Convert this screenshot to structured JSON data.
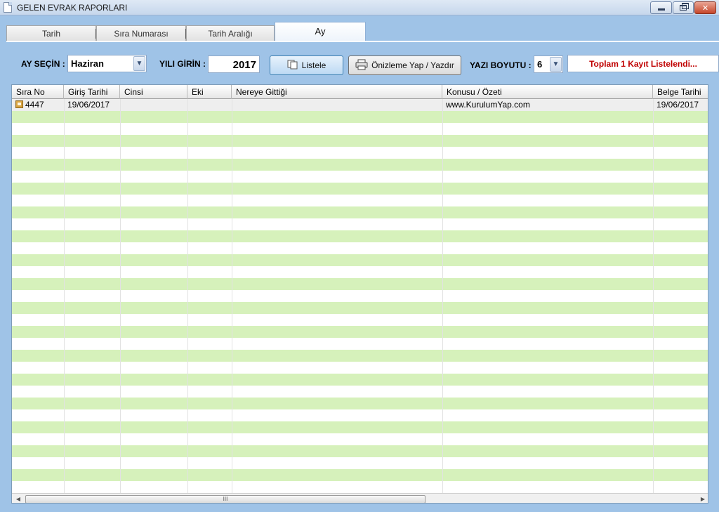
{
  "window": {
    "title": "GELEN EVRAK RAPORLARI",
    "controls": {
      "minimize": "minimize",
      "maximize": "restore",
      "close": "✕"
    }
  },
  "tabs": [
    {
      "label": "Tarih",
      "active": false
    },
    {
      "label": "Sıra Numarası",
      "active": false
    },
    {
      "label": "Tarih Aralığı",
      "active": false
    },
    {
      "label": "Ay",
      "active": true
    }
  ],
  "filters": {
    "month_label": "AY SEÇİN :",
    "month_value": "Haziran",
    "year_label": "YILI GİRİN :",
    "year_value": "2017",
    "list_button": "Listele",
    "print_button": "Önizleme Yap / Yazdır",
    "font_size_label": "YAZI BOYUTU :",
    "font_size_value": "6",
    "status": "Toplam 1 Kayıt Listelendi..."
  },
  "grid": {
    "columns": [
      "Sıra No",
      "Giriş Tarihi",
      "Cinsi",
      "Eki",
      "Nereye Gittiği",
      "Konusu / Özeti",
      "Belge Tarihi"
    ],
    "rows": [
      {
        "sira_no": "4447",
        "giris_tarihi": "19/06/2017",
        "cinsi": "",
        "eki": "",
        "nereye_gittigi": "",
        "konusu": "www.KurulumYap.com",
        "belge_tarihi": "19/06/2017"
      }
    ],
    "colors": {
      "alt_row": "#d6f1bb",
      "header": "#e6e6e6",
      "status_text": "#c00000"
    }
  },
  "scrollbar": {
    "thumb_grip": "III"
  }
}
